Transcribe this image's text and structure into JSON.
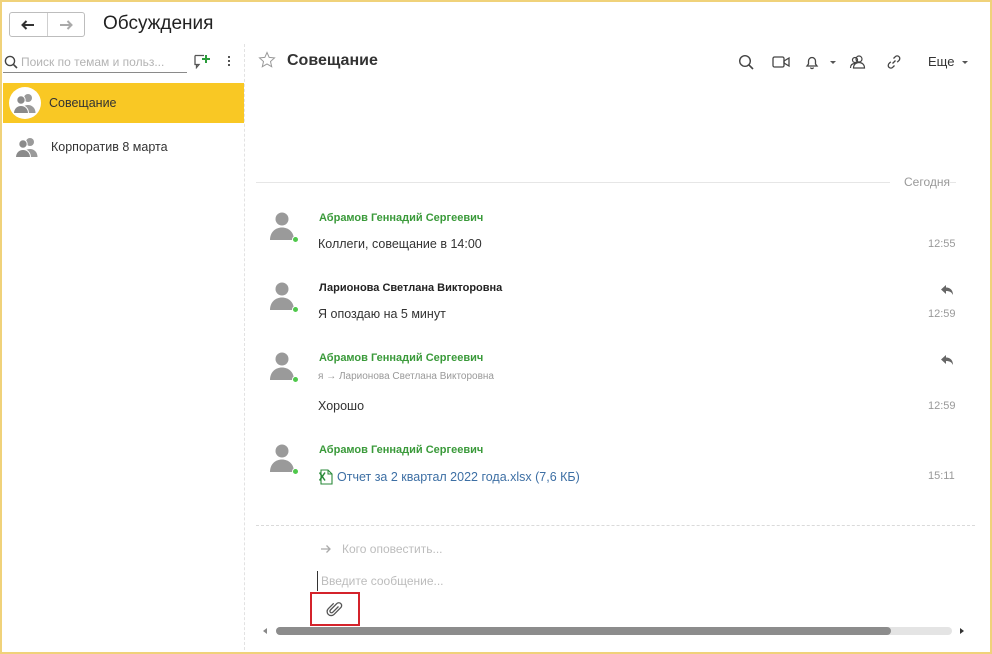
{
  "window": {
    "title": "Обсуждения",
    "back_icon": "arrow-left-icon",
    "forward_icon": "arrow-right-icon"
  },
  "sidebar": {
    "search_placeholder": "Поиск по темам и польз...",
    "add_icon": "add-topic-icon",
    "more_icon": "vertical-dots-icon",
    "items": [
      {
        "label": "Совещание",
        "active": true,
        "icon": "group-avatar-icon"
      },
      {
        "label": "Корпоратив 8 марта",
        "active": false,
        "icon": "group-avatar-icon"
      }
    ]
  },
  "conversation": {
    "title": "Совещание",
    "favorite_icon": "star-icon",
    "toolbar": {
      "search_icon": "search-icon",
      "video_icon": "video-call-icon",
      "bell_icon": "bell-icon",
      "members_icon": "members-icon",
      "link_icon": "link-icon",
      "more_label": "Еще"
    },
    "date_separator": "Сегодня",
    "messages": [
      {
        "author": "Абрамов Геннадий Сергеевич",
        "author_color": "#3a9a3a",
        "text": "Коллеги, совещание в 14:00",
        "time": "12:55",
        "reply": false
      },
      {
        "author": "Ларионова Светлана Викторовна",
        "author_color": "#222222",
        "text": "Я опоздаю на 5 минут",
        "time": "12:59",
        "reply": true
      },
      {
        "author": "Абрамов Геннадий Сергеевич",
        "author_color": "#3a9a3a",
        "forward": "я → Ларионова Светлана Викторовна",
        "text": "Хорошо",
        "time": "12:59",
        "reply": true
      },
      {
        "author": "Абрамов Геннадий Сергеевич",
        "author_color": "#3a9a3a",
        "file": "Отчет за 2 квартал 2022 года.xlsx (7,6 КБ)",
        "file_icon": "excel-file-icon",
        "time": "15:11",
        "reply": false
      }
    ],
    "compose": {
      "notify_placeholder": "Кого оповестить...",
      "message_placeholder": "Введите сообщение...",
      "attach_icon": "paperclip-icon"
    },
    "scrollbar_position": 0.91
  },
  "colors": {
    "active_topic": "#f9c824",
    "online": "#4fc84b",
    "highlight_box": "#d4232b",
    "link": "#3d6fa4"
  }
}
